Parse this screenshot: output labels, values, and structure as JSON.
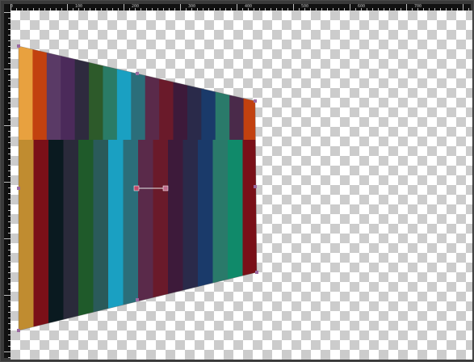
{
  "window": {
    "title": ""
  },
  "ruler": {
    "horizontal_labels": [
      "0",
      "100",
      "200",
      "300",
      "400",
      "500",
      "600",
      "700"
    ]
  },
  "canvas": {
    "background": "transparency-checkerboard",
    "checker_colors": [
      "#ffffff",
      "#cccccc"
    ]
  },
  "image_layer": {
    "name": "",
    "stripe_colors_top": [
      "#e8a13f",
      "#c2410f",
      "#5a3a66",
      "#4b2a5a",
      "#2e2a3e",
      "#2d5a2a",
      "#2a7b66",
      "#1aa0c2",
      "#2b6e7a",
      "#5a2a4a",
      "#6a1a2a",
      "#3d1a3a",
      "#2a2a4a",
      "#1a3a6a",
      "#2a7a6a",
      "#4a2a4a",
      "#c2410f"
    ],
    "stripe_colors_bottom": [
      "#c08c30",
      "#7a1018",
      "#0a1a20",
      "#2a2a3a",
      "#1f5a2a",
      "#2a5a5a",
      "#1aa0c2",
      "#2b6e7a",
      "#5a2a4a",
      "#6a1a2a",
      "#3d1a3a",
      "#2a2a4a",
      "#1a3a6a",
      "#2a7a6a",
      "#108a6a",
      "#7a1018"
    ]
  },
  "transform_handles": {
    "accent_color": "#c24a6a",
    "handle_fill": "#9a6aa0"
  }
}
